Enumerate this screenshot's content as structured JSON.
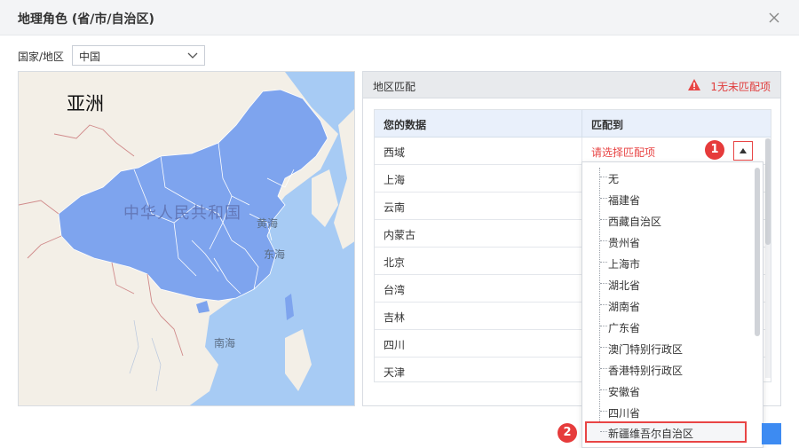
{
  "dialog": {
    "title": "地理角色 (省/市/自治区)",
    "country_label": "国家/地区",
    "country_value": "中国"
  },
  "map": {
    "labels": {
      "asia": "亚洲",
      "china": "中华人民共和国",
      "yellow_sea": "黄海",
      "east_sea": "东海",
      "south_sea": "南海"
    },
    "colors": {
      "land": "#f3efe7",
      "water": "#a7cbf4",
      "highlight": "#7ea4ee",
      "border": "#d08a8a"
    }
  },
  "match": {
    "title": "地区匹配",
    "unmatched_text": "1无未匹配项",
    "columns": [
      "您的数据",
      "匹配到"
    ],
    "rows": [
      "西域",
      "上海",
      "云南",
      "内蒙古",
      "北京",
      "台湾",
      "吉林",
      "四川",
      "天津"
    ],
    "first_row_prompt": "请选择匹配项"
  },
  "dropdown": {
    "options": [
      "无",
      "福建省",
      "西藏自治区",
      "贵州省",
      "上海市",
      "湖北省",
      "湖南省",
      "广东省",
      "澳门特别行政区",
      "香港特别行政区",
      "安徽省",
      "四川省",
      "新疆维吾尔自治区"
    ],
    "selected": "新疆维吾尔自治区"
  },
  "annotations": {
    "badge1": "1",
    "badge2": "2"
  },
  "colors": {
    "accent": "#3d8bf2",
    "alert": "#e84545"
  }
}
